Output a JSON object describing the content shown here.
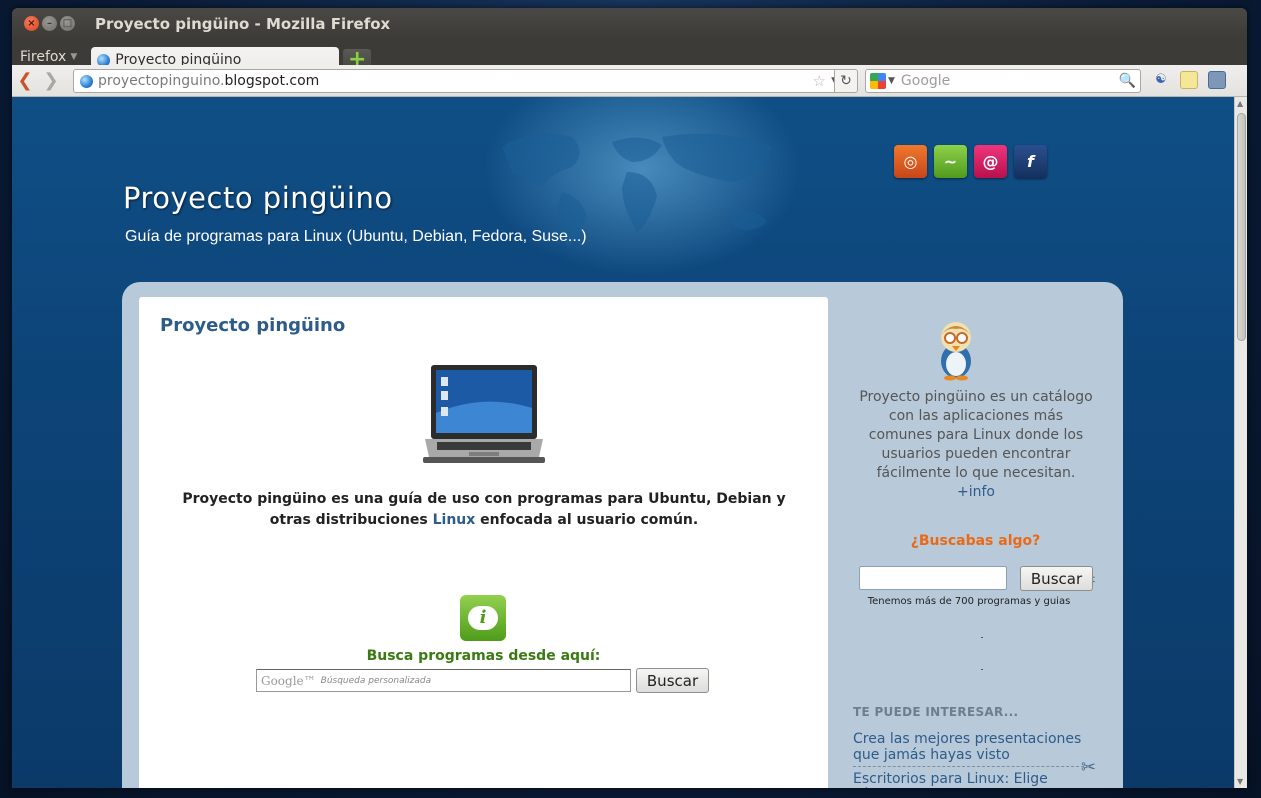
{
  "window": {
    "title": "Proyecto pingüino - Mozilla Firefox"
  },
  "tabbar": {
    "menu_label": "Firefox",
    "tabs": [
      {
        "label": "Proyecto pingüino"
      }
    ],
    "new_tab_label": "+"
  },
  "navbar": {
    "url_host": "proyectopinguino.",
    "url_domain": "blogspot.com",
    "search_placeholder": "Google"
  },
  "page": {
    "blog_title": "Proyecto pingüino",
    "blog_subtitle": "Guía de programas para Linux (Ubuntu, Debian, Fedora, Suse...)",
    "distro_icons": [
      "ubuntu-icon",
      "opensuse-icon",
      "debian-icon",
      "fedora-icon"
    ],
    "post_title": "Proyecto pingüino",
    "intro_before": "Proyecto pingüino es una guía de uso con programas para Ubuntu, Debian y otras distribuciones ",
    "intro_link": "Linux",
    "intro_after": " enfocada al usuario común.",
    "search_label": "Busca programas desde aquí:",
    "search_logo": "Google™",
    "search_placeholder": "Búsqueda personalizada",
    "search_button": "Buscar"
  },
  "sidebar": {
    "description": "Proyecto pingüino es un catálogo con las aplicaciones más comunes para Linux donde los usuarios pueden encontrar fácilmente lo que necesitan. ",
    "info_link": "+info",
    "search_heading": "¿Buscabas algo?",
    "search_button": "Buscar",
    "search_note": "Tenemos más de 700 programas y guias",
    "interest_heading": "TE PUEDE INTERESAR...",
    "links": [
      {
        "label": "Crea las mejores presentaciones que jamás hayas visto"
      },
      {
        "label": "Escritorios para Linux: Elige cómo quieres que se vea tu ordenador"
      }
    ]
  },
  "colors": {
    "link": "#2d5c8b",
    "sidebar_heading": "#e86a16",
    "search_label": "#3a7a12",
    "header_bg": "#0f4f86",
    "panel_bg": "#b8c9d9"
  }
}
